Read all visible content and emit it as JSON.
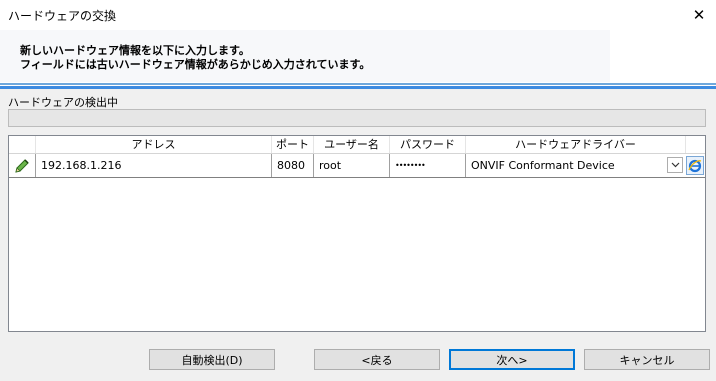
{
  "window": {
    "title": "ハードウェアの交換"
  },
  "header": {
    "line1": "新しいハードウェア情報を以下に入力します。",
    "line2": "フィールドには古いハードウェア情報があらかじめ入力されています。"
  },
  "detection": {
    "label": "ハードウェアの検出中",
    "progress": 0
  },
  "grid": {
    "columns": [
      "アドレス",
      "ポート",
      "ユーザー名",
      "パスワード",
      "ハードウェアドライバー"
    ],
    "rows": [
      {
        "address": "192.168.1.216",
        "port": "8080",
        "username": "root",
        "password": "••••••••",
        "driver": "ONVIF Conformant Device"
      }
    ]
  },
  "buttons": {
    "auto_detect": "自動検出(D)",
    "back": "<戻る",
    "next": "次へ>",
    "cancel": "キャンセル"
  },
  "icons": {
    "close": "close-icon",
    "edit": "pencil-icon",
    "dropdown": "chevron-down-icon",
    "browser": "internet-explorer-icon"
  },
  "colors": {
    "accent": "#3d8be0",
    "default_button_border": "#0078d7"
  }
}
